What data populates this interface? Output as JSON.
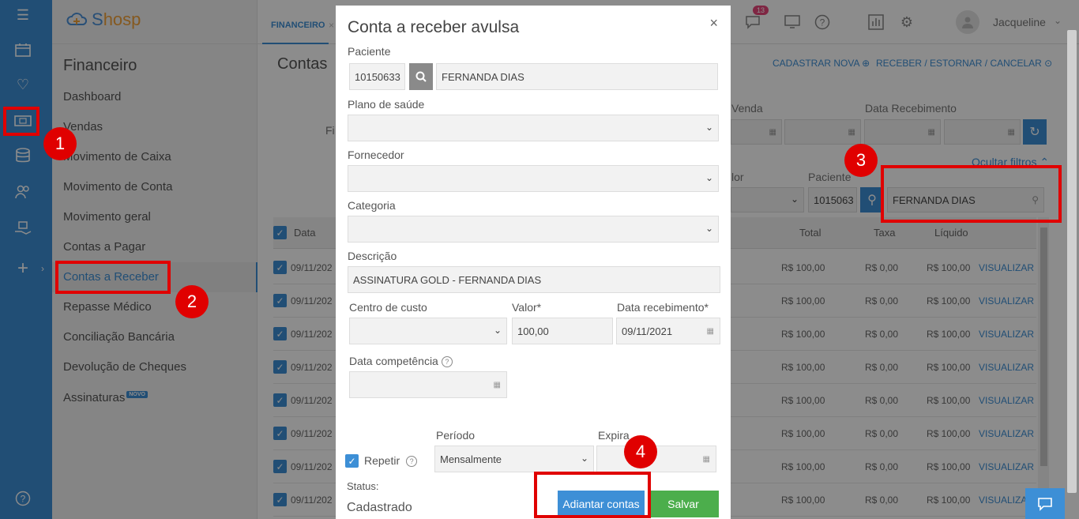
{
  "app": {
    "logo_prefix": "S",
    "logo_rest": "hosp"
  },
  "sidebar": {
    "title": "Financeiro",
    "items": [
      {
        "label": "Dashboard"
      },
      {
        "label": "Vendas"
      },
      {
        "label": "Movimento de Caixa"
      },
      {
        "label": "Movimento de Conta"
      },
      {
        "label": "Movimento geral"
      },
      {
        "label": "Contas a Pagar"
      },
      {
        "label": "Contas a Receber"
      },
      {
        "label": "Repasse Médico"
      },
      {
        "label": "Conciliação Bancária"
      },
      {
        "label": "Devolução de Cheques"
      },
      {
        "label": "Assinaturas"
      }
    ],
    "novo_badge": "NOVO"
  },
  "topbar": {
    "tab_label": "FINANCEIRO",
    "tab_close": "×",
    "notification_count": "13",
    "user_name": "Jacqueline"
  },
  "page": {
    "title": "Contas",
    "cadastrar_nova": "CADASTRAR NOVA",
    "receber_estornar": "RECEBER / ESTORNAR / CANCELAR",
    "filter_label_fi": "Fi",
    "filter_venda": "Venda",
    "filter_data_recebimento": "Data Recebimento",
    "ocultar_filtros": "Ocultar filtros",
    "filter_valor": "lor",
    "filter_paciente": "Paciente",
    "paciente_code": "1015063",
    "paciente_name": "FERNANDA DIAS"
  },
  "table": {
    "headers": {
      "data": "Data",
      "total": "Total",
      "taxa": "Taxa",
      "liquido": "Líquido"
    },
    "rows": [
      {
        "date": "09/11/202",
        "total": "R$ 100,00",
        "taxa": "R$ 0,00",
        "liquido": "R$ 100,00",
        "action": "VISUALIZAR"
      },
      {
        "date": "09/11/202",
        "total": "R$ 100,00",
        "taxa": "R$ 0,00",
        "liquido": "R$ 100,00",
        "action": "VISUALIZAR"
      },
      {
        "date": "09/11/202",
        "total": "R$ 100,00",
        "taxa": "R$ 0,00",
        "liquido": "R$ 100,00",
        "action": "VISUALIZAR"
      },
      {
        "date": "09/11/202",
        "total": "R$ 100,00",
        "taxa": "R$ 0,00",
        "liquido": "R$ 100,00",
        "action": "VISUALIZAR"
      },
      {
        "date": "09/11/202",
        "total": "R$ 100,00",
        "taxa": "R$ 0,00",
        "liquido": "R$ 100,00",
        "action": "VISUALIZAR"
      },
      {
        "date": "09/11/202",
        "total": "R$ 100,00",
        "taxa": "R$ 0,00",
        "liquido": "R$ 100,00",
        "action": "VISUALIZAR"
      },
      {
        "date": "09/11/202",
        "total": "R$ 100,00",
        "taxa": "R$ 0,00",
        "liquido": "R$ 100,00",
        "action": "VISUALIZAR"
      },
      {
        "date": "09/11/202",
        "total": "R$ 100,00",
        "taxa": "R$ 0,00",
        "liquido": "R$ 100,00",
        "action": "VISUALIZA"
      }
    ]
  },
  "modal": {
    "title": "Conta a receber avulsa",
    "close": "×",
    "paciente_label": "Paciente",
    "paciente_code": "10150633",
    "paciente_name": "FERNANDA DIAS",
    "plano_label": "Plano de saúde",
    "plano_value": "",
    "fornecedor_label": "Fornecedor",
    "fornecedor_value": "",
    "categoria_label": "Categoria",
    "categoria_value": "",
    "descricao_label": "Descrição",
    "descricao_value": "ASSINATURA GOLD - FERNANDA DIAS",
    "centro_label": "Centro de custo",
    "centro_value": "",
    "valor_label": "Valor*",
    "valor_value": "100,00",
    "data_receb_label": "Data recebimento*",
    "data_receb_value": "09/11/2021",
    "data_comp_label": "Data competência",
    "data_comp_value": "",
    "periodo_label": "Período",
    "periodo_value": "Mensalmente",
    "expira_label": "Expira",
    "expira_value": "",
    "repetir_label": "Repetir",
    "repetir_checked": true,
    "status_label": "Status:",
    "status_value": "Cadastrado",
    "adiantar_label": "Adiantar contas",
    "salvar_label": "Salvar"
  },
  "annotations": {
    "m1": "1",
    "m2": "2",
    "m3": "3",
    "m4": "4"
  },
  "colors": {
    "accent": "#3d8fd6",
    "success": "#4cae4c",
    "highlight": "#e00000",
    "badge": "#e8467b"
  }
}
